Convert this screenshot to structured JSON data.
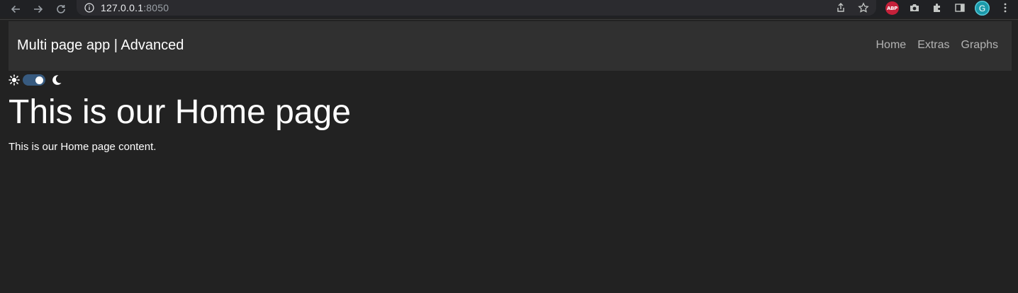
{
  "browser": {
    "url_host": "127.0.0.1",
    "url_port": ":8050",
    "extension_abp_label": "ABP",
    "profile_initial": "G",
    "icons": [
      "back-arrow-icon",
      "forward-arrow-icon",
      "reload-icon",
      "info-icon",
      "share-icon",
      "bookmark-star-icon",
      "abp-icon",
      "camera-icon",
      "puzzle-extensions-icon",
      "sidepanel-icon",
      "profile-avatar",
      "kebab-menu-icon"
    ]
  },
  "navbar": {
    "brand": "Multi page app | Advanced",
    "links": [
      "Home",
      "Extras",
      "Graphs"
    ]
  },
  "theme_switch": {
    "light_icon": "sun-icon",
    "dark_icon": "moon-icon",
    "state": "dark",
    "accent_color": "#375a7f"
  },
  "page": {
    "heading": "This is our Home page",
    "content": "This is our Home page content."
  },
  "colors": {
    "background": "#222222",
    "navbar_bg": "#303030",
    "link_color": "#b3b3b3"
  }
}
